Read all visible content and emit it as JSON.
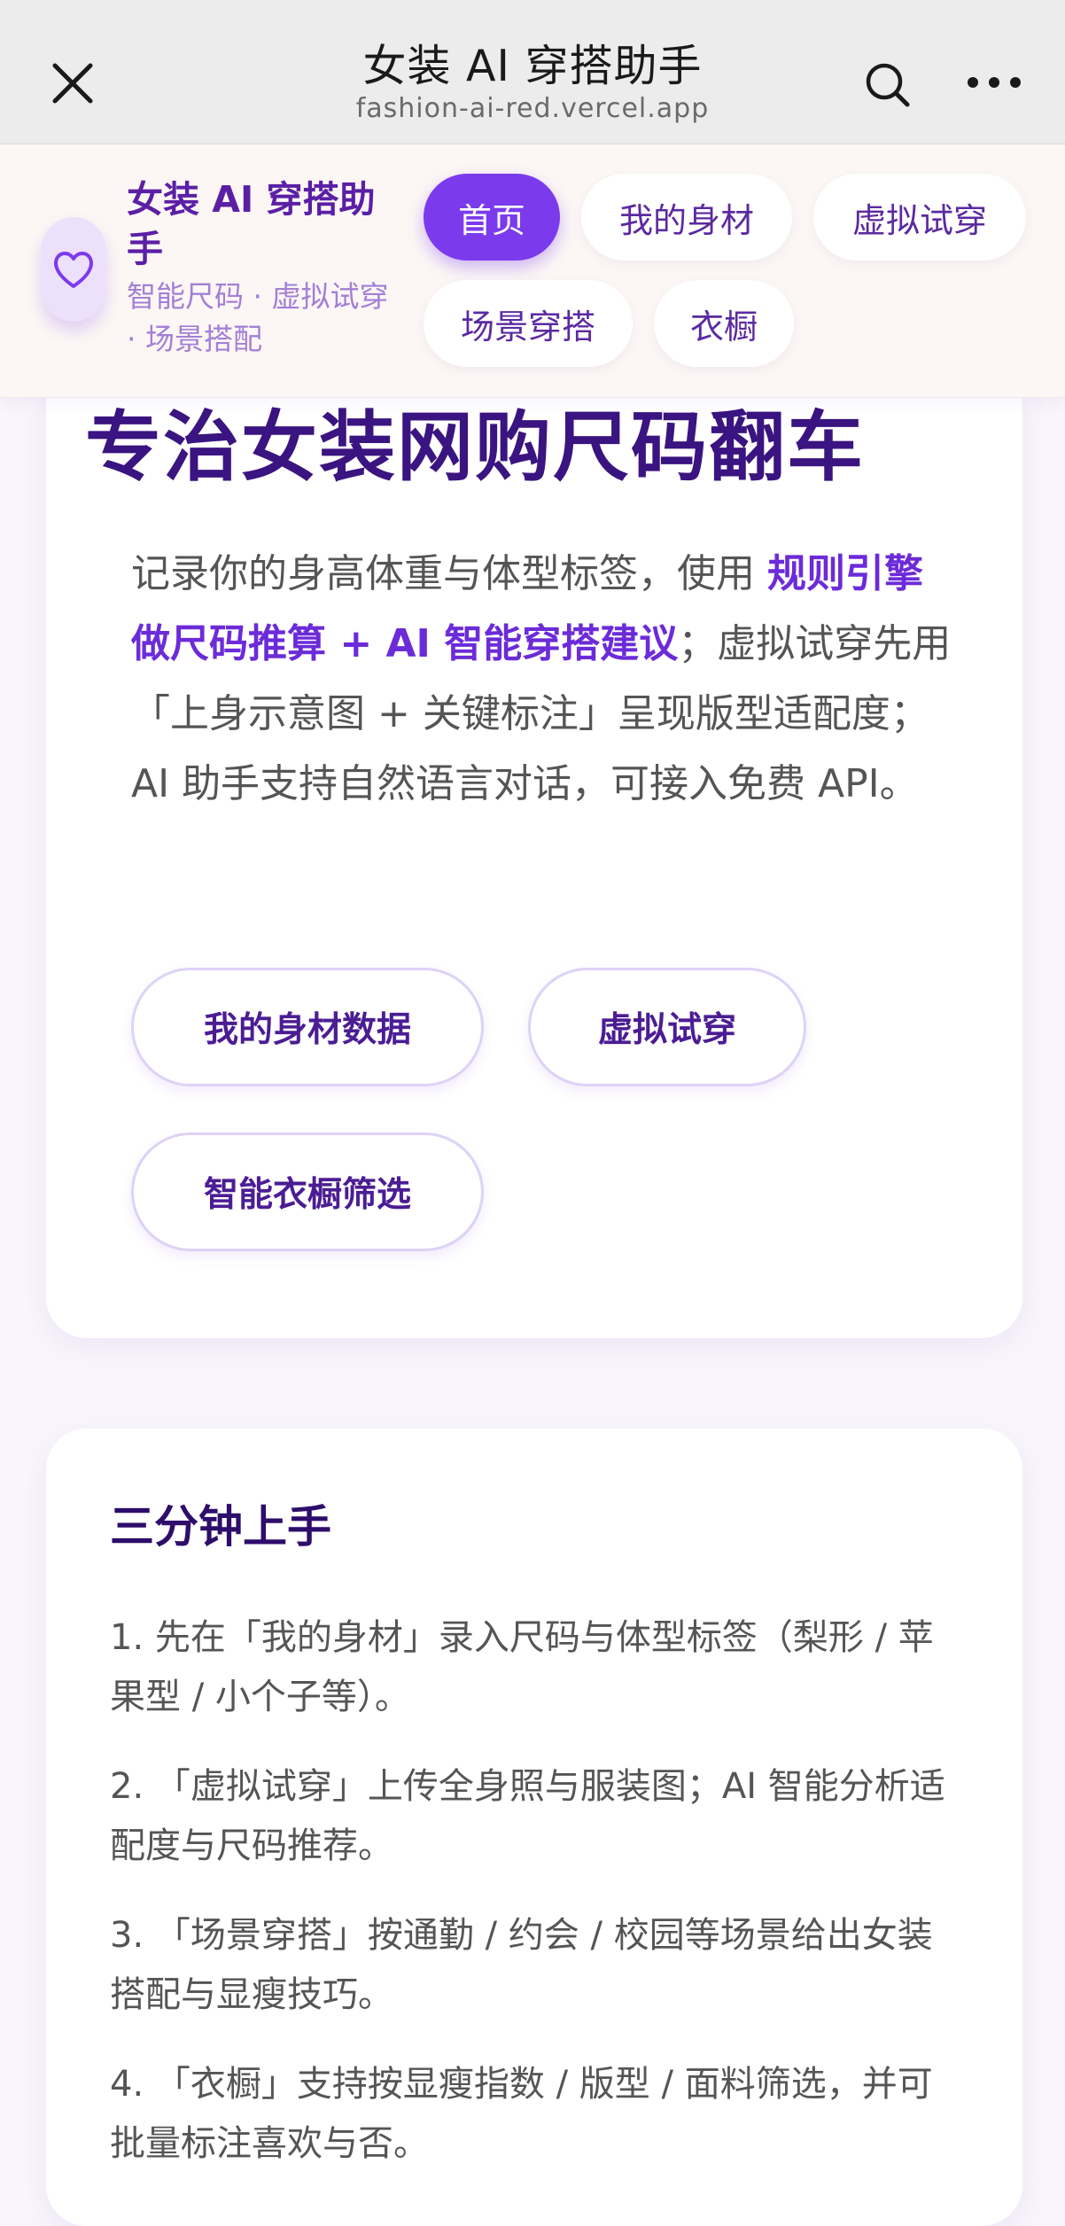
{
  "browser": {
    "title": "女装 AI 穿搭助手",
    "url": "fashion-ai-red.vercel.app"
  },
  "header": {
    "brand_title": "女装 AI 穿搭助手",
    "brand_subtitle": "智能尺码 · 虚拟试穿 · 场景搭配",
    "logo_icon": "heart-icon",
    "nav": [
      "首页",
      "我的身材",
      "虚拟试穿",
      "场景穿搭",
      "衣橱"
    ],
    "active_nav": "首页"
  },
  "hero": {
    "title": "专治女装网购尺码翻车",
    "desc_before": "记录你的身高体重与体型标签，使用 ",
    "desc_highlight": "规则引擎做尺码推算 + AI 智能穿搭建议",
    "desc_after": "；虚拟试穿先用「上身示意图 + 关键标注」呈现版型适配度；AI 助手支持自然语言对话，可接入免费 API。",
    "buttons": [
      "我的身材数据",
      "虚拟试穿",
      "智能衣橱筛选"
    ]
  },
  "quickstart": {
    "heading": "三分钟上手",
    "items": [
      "1. 先在「我的身材」录入尺码与体型标签（梨形 / 苹果型 / 小个子等）。",
      "2. 「虚拟试穿」上传全身照与服装图；AI 智能分析适配度与尺码推荐。",
      "3. 「场景穿搭」按通勤 / 约会 / 校园等场景给出女装搭配与显瘦技巧。",
      "4. 「衣橱」支持按显瘦指数 / 版型 / 面料筛选，并可批量标注喜欢与否。"
    ]
  },
  "colors": {
    "accent": "#7c3aed",
    "brand_text": "#5b1fa6",
    "heading": "#3a1480",
    "header_bg": "#fcf7f5",
    "page_bg": "#f8f5fc"
  }
}
